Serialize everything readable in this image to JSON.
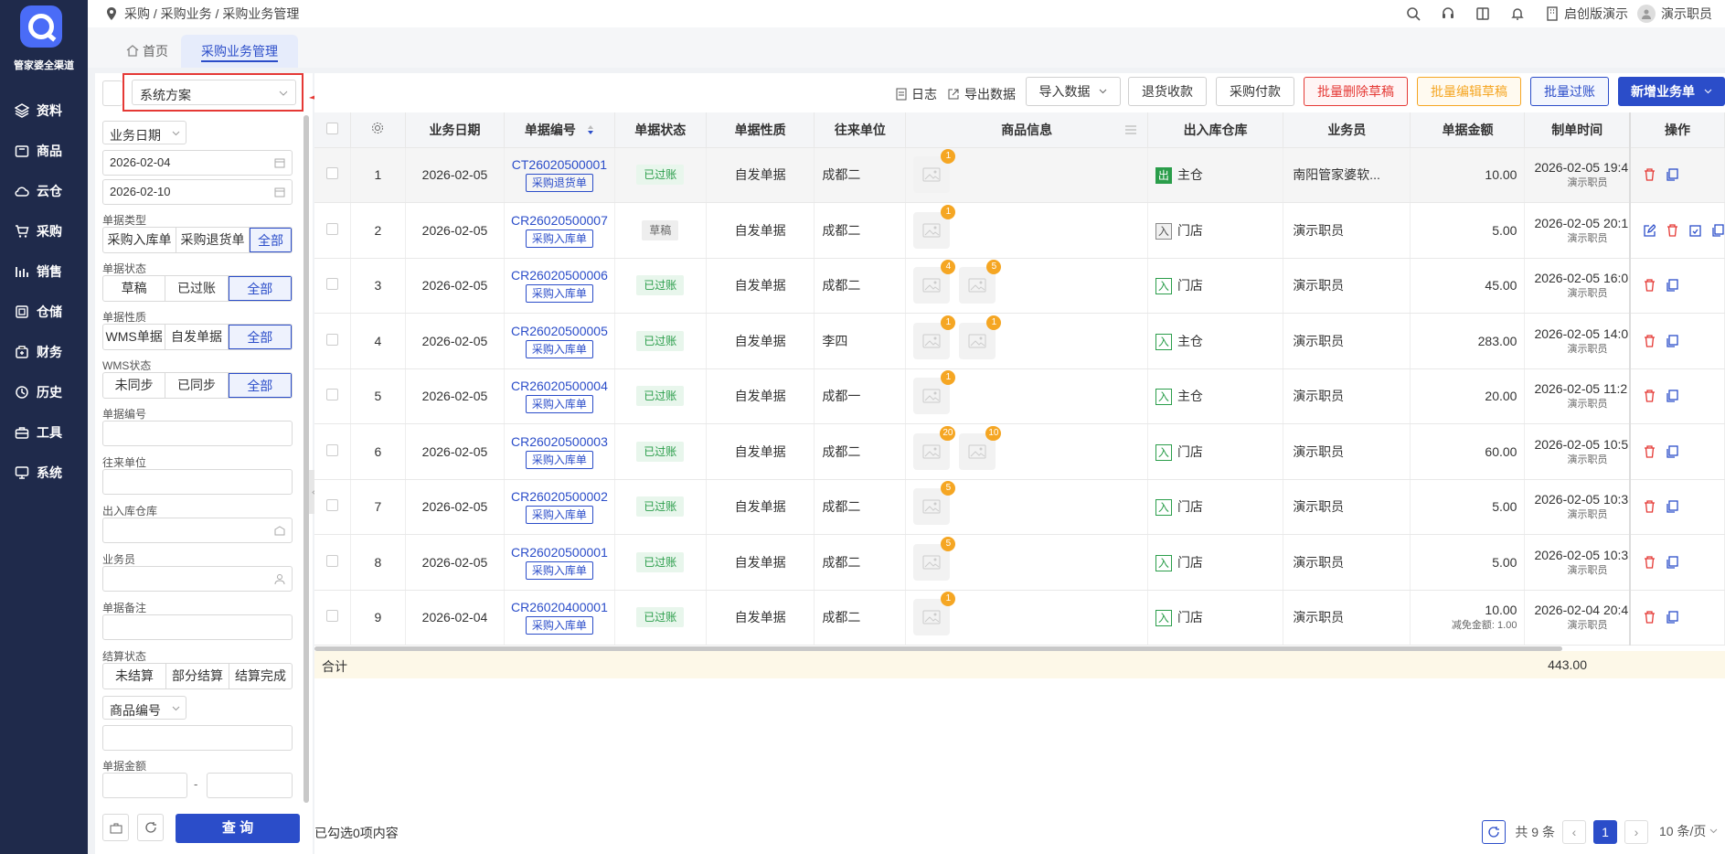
{
  "brand": {
    "name": "管家婆全渠道"
  },
  "nav": [
    {
      "label": "资料",
      "icon": "layers-icon"
    },
    {
      "label": "商品",
      "icon": "box-icon"
    },
    {
      "label": "云仓",
      "icon": "cloud-icon"
    },
    {
      "label": "采购",
      "icon": "cart-icon"
    },
    {
      "label": "销售",
      "icon": "chart-icon"
    },
    {
      "label": "仓储",
      "icon": "warehouse-icon"
    },
    {
      "label": "财务",
      "icon": "finance-icon"
    },
    {
      "label": "历史",
      "icon": "history-icon"
    },
    {
      "label": "工具",
      "icon": "toolbox-icon"
    },
    {
      "label": "系统",
      "icon": "monitor-icon"
    }
  ],
  "breadcrumb": "采购 / 采购业务 / 采购业务管理",
  "header": {
    "edition": "启创版演示",
    "user": "演示职员"
  },
  "tabs": [
    {
      "label": "首页"
    },
    {
      "label": "采购业务管理"
    }
  ],
  "filter": {
    "scheme": "系统方案",
    "date_type": "业务日期",
    "date_from": "2026-02-04",
    "date_to": "2026-02-10",
    "doc_type_label": "单据类型",
    "doc_type_options": [
      "采购入库单",
      "采购退货单",
      "全部"
    ],
    "doc_status_label": "单据状态",
    "doc_status_options": [
      "草稿",
      "已过账",
      "全部"
    ],
    "doc_nature_label": "单据性质",
    "doc_nature_options": [
      "WMS单据",
      "自发单据",
      "全部"
    ],
    "wms_label": "WMS状态",
    "wms_options": [
      "未同步",
      "已同步",
      "全部"
    ],
    "doc_no_label": "单据编号",
    "partner_label": "往来单位",
    "warehouse_label": "出入库仓库",
    "staff_label": "业务员",
    "remark_label": "单据备注",
    "settle_label": "结算状态",
    "settle_options": [
      "未结算",
      "部分结算",
      "结算完成"
    ],
    "goods_no_select": "商品编号",
    "amount_label": "单据金额",
    "amount_sep": "-",
    "query_button": "查 询"
  },
  "toolbar": {
    "log": "日志",
    "export": "导出数据",
    "import": "导入数据",
    "refund": "退货收款",
    "pay": "采购付款",
    "batch_delete": "批量删除草稿",
    "batch_edit": "批量编辑草稿",
    "batch_post": "批量过账",
    "new_business": "新增业务单"
  },
  "colors": {
    "sidebar": "#1f2a4b",
    "accent": "#2b4dc9",
    "danger": "#e53935",
    "warning": "#f5a623",
    "success": "#2a9d4a"
  },
  "table": {
    "columns": [
      "业务日期",
      "单据编号",
      "单据状态",
      "单据性质",
      "往来单位",
      "商品信息",
      "出入库仓库",
      "业务员",
      "单据金额",
      "制单时间",
      "操作"
    ],
    "rows": [
      {
        "no": "1",
        "date": "2026-02-05",
        "doc_no": "CT26020500001",
        "doc_type": "采购退货单",
        "status": "已过账",
        "nature": "自发单据",
        "partner": "成都二",
        "goods": [
          "1"
        ],
        "wh_tag": "出",
        "warehouse": "主仓",
        "staff": "南阳管家婆软...",
        "amount": "10.00",
        "created": "2026-02-05 19:4",
        "creator": "演示职员"
      },
      {
        "no": "2",
        "date": "2026-02-05",
        "doc_no": "CR26020500007",
        "doc_type": "采购入库单",
        "status": "草稿",
        "nature": "自发单据",
        "partner": "成都二",
        "goods": [
          "1"
        ],
        "wh_tag": "入",
        "warehouse": "门店",
        "staff": "演示职员",
        "amount": "5.00",
        "created": "2026-02-05 20:1",
        "creator": "演示职员"
      },
      {
        "no": "3",
        "date": "2026-02-05",
        "doc_no": "CR26020500006",
        "doc_type": "采购入库单",
        "status": "已过账",
        "nature": "自发单据",
        "partner": "成都二",
        "goods": [
          "4",
          "5"
        ],
        "wh_tag": "入",
        "warehouse": "门店",
        "staff": "演示职员",
        "amount": "45.00",
        "created": "2026-02-05 16:0",
        "creator": "演示职员"
      },
      {
        "no": "4",
        "date": "2026-02-05",
        "doc_no": "CR26020500005",
        "doc_type": "采购入库单",
        "status": "已过账",
        "nature": "自发单据",
        "partner": "李四",
        "goods": [
          "1",
          "1"
        ],
        "wh_tag": "入",
        "warehouse": "主仓",
        "staff": "演示职员",
        "amount": "283.00",
        "created": "2026-02-05 14:0",
        "creator": "演示职员"
      },
      {
        "no": "5",
        "date": "2026-02-05",
        "doc_no": "CR26020500004",
        "doc_type": "采购入库单",
        "status": "已过账",
        "nature": "自发单据",
        "partner": "成都一",
        "goods": [
          "1"
        ],
        "wh_tag": "入",
        "warehouse": "主仓",
        "staff": "演示职员",
        "amount": "20.00",
        "created": "2026-02-05 11:2",
        "creator": "演示职员"
      },
      {
        "no": "6",
        "date": "2026-02-05",
        "doc_no": "CR26020500003",
        "doc_type": "采购入库单",
        "status": "已过账",
        "nature": "自发单据",
        "partner": "成都二",
        "goods": [
          "20",
          "10"
        ],
        "wh_tag": "入",
        "warehouse": "门店",
        "staff": "演示职员",
        "amount": "60.00",
        "created": "2026-02-05 10:5",
        "creator": "演示职员"
      },
      {
        "no": "7",
        "date": "2026-02-05",
        "doc_no": "CR26020500002",
        "doc_type": "采购入库单",
        "status": "已过账",
        "nature": "自发单据",
        "partner": "成都二",
        "goods": [
          "5"
        ],
        "wh_tag": "入",
        "warehouse": "门店",
        "staff": "演示职员",
        "amount": "5.00",
        "created": "2026-02-05 10:3",
        "creator": "演示职员"
      },
      {
        "no": "8",
        "date": "2026-02-05",
        "doc_no": "CR26020500001",
        "doc_type": "采购入库单",
        "status": "已过账",
        "nature": "自发单据",
        "partner": "成都二",
        "goods": [
          "5"
        ],
        "wh_tag": "入",
        "warehouse": "门店",
        "staff": "演示职员",
        "amount": "5.00",
        "created": "2026-02-05 10:3",
        "creator": "演示职员"
      },
      {
        "no": "9",
        "date": "2026-02-04",
        "doc_no": "CR26020400001",
        "doc_type": "采购入库单",
        "status": "已过账",
        "nature": "自发单据",
        "partner": "成都二",
        "goods": [
          "1"
        ],
        "wh_tag": "入",
        "warehouse": "门店",
        "staff": "演示职员",
        "amount": "10.00",
        "amount_note": "减免金额: 1.00",
        "created": "2026-02-04 20:4",
        "creator": "演示职员"
      }
    ],
    "sum_label": "合计",
    "sum_amount": "443.00"
  },
  "footer": {
    "selected": "已勾选0项内容",
    "total": "共 9 条",
    "page": "1",
    "page_size": "10 条/页"
  }
}
